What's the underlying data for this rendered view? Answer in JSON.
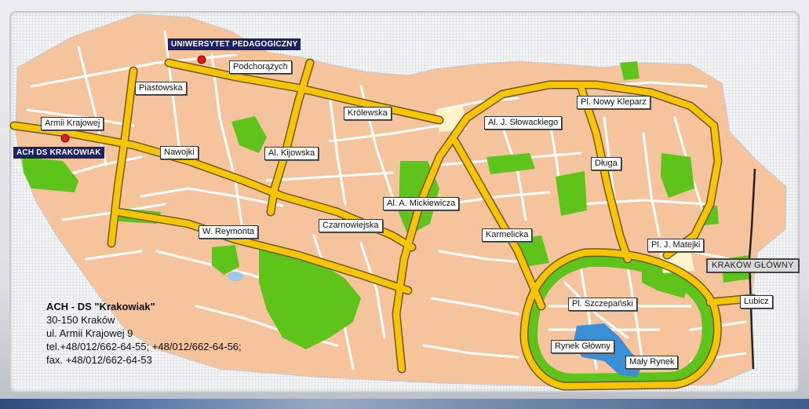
{
  "map": {
    "labels": {
      "uniwersytet": "UNIWERSYTET PEDAGOGICZNY",
      "ach_ds": "ACH DS KRAKOWIAK",
      "podchorazych": "Podchorążych",
      "piastowska": "Piastowska",
      "armii_krajowej": "Armii Krajowej",
      "krolewska": "Królewska",
      "nawojki": "Nawojki",
      "kijowska": "Al. Kijowska",
      "slowackiego": "Al. J. Słowackiego",
      "nowy_kleparz": "Pl. Nowy Kleparz",
      "dluga": "Długa",
      "mickiewicza": "Al. A. Mickiewicza",
      "czarnowiejska": "Czarnowiejska",
      "reymonta": "W. Reymonta",
      "karmelicka": "Karmelicka",
      "matejki": "Pl. J. Matejki",
      "krakow_glowny": "KRAKÓW GŁÓWNY",
      "lubicz": "Lubicz",
      "szczepanski": "Pl. Szczepański",
      "rynek_glowny": "Rynek Główny",
      "maly_rynek": "Mały Rynek"
    },
    "colors": {
      "land": "#f5c39c",
      "street": "#ffffff",
      "main_road": "#f9c500",
      "road_edge": "#6b5a2a",
      "park": "#5ec41a",
      "water": "#3a8fd6",
      "marker": "#e41b13",
      "label_dark_bg": "#1c2166"
    }
  },
  "address": {
    "title": "ACH - DS \"Krakowiak\"",
    "city": "30-150 Kraków",
    "street": "ul. Armii Krajowej 9",
    "tel": "tel.+48/012/662-64-55; +48/012/662-64-56;",
    "fax": "fax. +48/012/662-64-53"
  }
}
